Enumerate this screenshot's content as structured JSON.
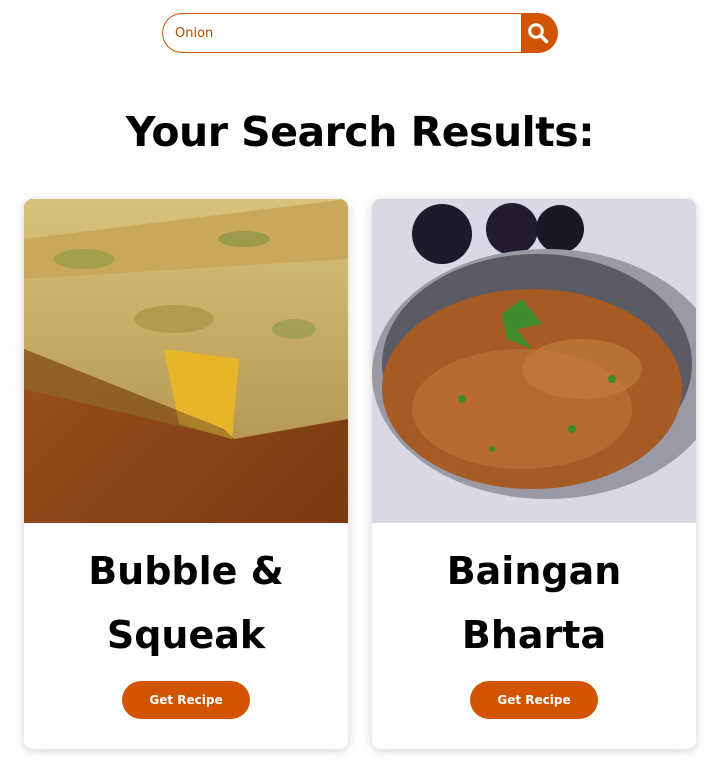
{
  "search": {
    "value": "Onion",
    "button_icon": "search-icon"
  },
  "results": {
    "heading": "Your Search Results:",
    "cards": [
      {
        "title_line1": "Bubble &",
        "title_line2": "Squeak",
        "button_label": "Get Recipe"
      },
      {
        "title_line1": "Baingan",
        "title_line2": "Bharta",
        "button_label": "Get Recipe"
      }
    ]
  },
  "colors": {
    "accent": "#d35400",
    "heading": "#000000"
  }
}
